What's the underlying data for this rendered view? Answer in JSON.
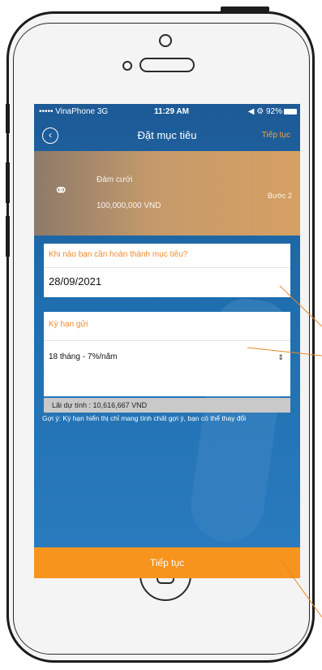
{
  "status_bar": {
    "carrier": "••••• VinaPhone",
    "network": "3G",
    "time": "11:29 AM",
    "right": "◀ ⚙ 92%"
  },
  "nav": {
    "title": "Đặt mục tiêu",
    "next_label": "Tiếp tục"
  },
  "goal": {
    "name": "Đám cưới",
    "amount": "100,000,000 VND",
    "step": "Bước 2"
  },
  "date_field": {
    "question": "Khi nào bạn cần hoàn thành mục tiêu?",
    "value": "28/09/2021"
  },
  "term_field": {
    "label": "Kỳ hạn gửi",
    "selected": "18 tháng - 7%/năm"
  },
  "interest_text": "Lãi dự tính : 10,616,667 VND",
  "hint_text": "Gợi ý: Kỳ hạn hiển thị chỉ mang tính chất gợi ý, bạn có thể thay đổi",
  "cta_label": "Tiếp tục",
  "colors": {
    "accent": "#f7941d",
    "primary_blue": "#1f6fb0",
    "question_text": "#f08a2b"
  }
}
